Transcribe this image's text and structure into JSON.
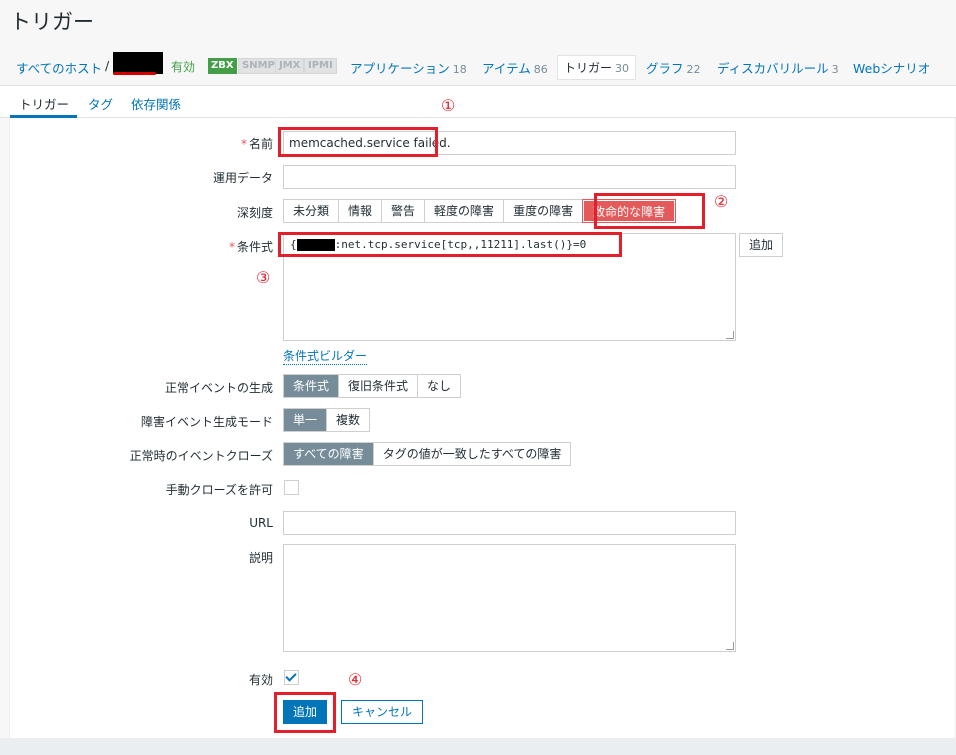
{
  "page": {
    "title": "トリガー"
  },
  "host_nav": {
    "all_hosts": "すべてのホスト",
    "separator": "/",
    "status": "有効",
    "badges": [
      "ZBX",
      "SNMP",
      "JMX",
      "IPMI"
    ],
    "applications": {
      "label": "アプリケーション",
      "count": "18"
    },
    "items": {
      "label": "アイテム",
      "count": "86"
    },
    "triggers": {
      "label": "トリガー",
      "count": "30"
    },
    "graphs": {
      "label": "グラフ",
      "count": "22"
    },
    "discovery": {
      "label": "ディスカバリルール",
      "count": "3"
    },
    "web": {
      "label": "Webシナリオ"
    }
  },
  "subtabs": [
    "トリガー",
    "タグ",
    "依存関係"
  ],
  "form": {
    "name": {
      "label": "名前",
      "value": "memcached.service failed."
    },
    "opdata": {
      "label": "運用データ",
      "value": ""
    },
    "severity": {
      "label": "深刻度",
      "options": [
        "未分類",
        "情報",
        "警告",
        "軽度の障害",
        "重度の障害",
        "致命的な障害"
      ],
      "selected": "致命的な障害"
    },
    "expression": {
      "label": "条件式",
      "prefix": "{",
      "suffix": ":net.tcp.service[tcp,,11211].last()}=0",
      "add_button": "追加",
      "builder_link": "条件式ビルダー"
    },
    "ok_event_gen": {
      "label": "正常イベントの生成",
      "options": [
        "条件式",
        "復旧条件式",
        "なし"
      ],
      "selected": "条件式"
    },
    "problem_mode": {
      "label": "障害イベント生成モード",
      "options": [
        "単一",
        "複数"
      ],
      "selected": "単一"
    },
    "ok_close": {
      "label": "正常時のイベントクローズ",
      "options": [
        "すべての障害",
        "タグの値が一致したすべての障害"
      ],
      "selected": "すべての障害"
    },
    "manual_close": {
      "label": "手動クローズを許可",
      "checked": false
    },
    "url": {
      "label": "URL",
      "value": ""
    },
    "description": {
      "label": "説明",
      "value": ""
    },
    "enabled": {
      "label": "有効",
      "checked": true
    },
    "buttons": {
      "add": "追加",
      "cancel": "キャンセル"
    }
  },
  "annotations": [
    "①",
    "②",
    "③",
    "④"
  ],
  "colors": {
    "accent": "#0275b8",
    "disaster": "#e45959",
    "highlight": "#e21f2a",
    "enabled_green": "#429e47"
  }
}
